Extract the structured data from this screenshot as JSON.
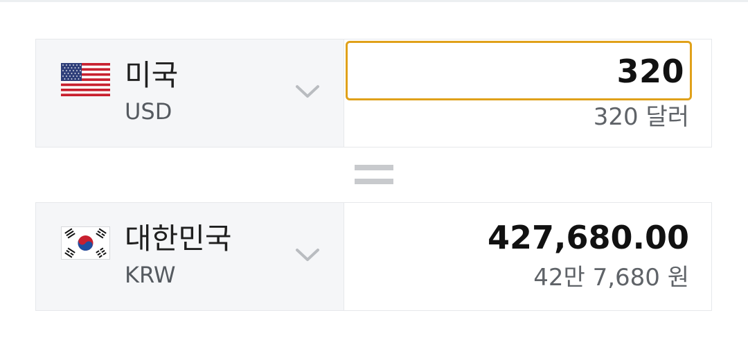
{
  "converter": {
    "from": {
      "country_name": "미국",
      "currency_code": "USD",
      "flag_icon": "us-flag-icon",
      "amount_value": "320",
      "amount_words": "320 달러"
    },
    "to": {
      "country_name": "대한민국",
      "currency_code": "KRW",
      "flag_icon": "kr-flag-icon",
      "amount_value": "427,680.00",
      "amount_words": "42만 7,680 원"
    },
    "equals_icon": "equals-icon",
    "dropdown_icon": "chevron-down-icon"
  },
  "colors": {
    "input_focus_border": "#e0a11a",
    "country_panel_bg": "#f5f6f8",
    "divider": "#e6e8eb"
  }
}
